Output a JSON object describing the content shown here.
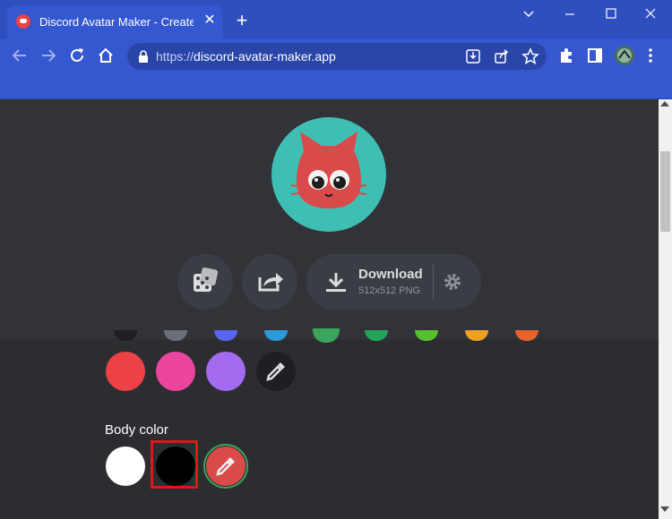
{
  "browser": {
    "tab_title": "Discord Avatar Maker - Create yo",
    "close_tab": "✕",
    "new_tab": "+",
    "url_scheme": "https://",
    "url_host": "discord-avatar-maker.app"
  },
  "download": {
    "label": "Download",
    "sublabel": "512x512 PNG"
  },
  "section": {
    "body_color_label": "Body color"
  },
  "colors": {
    "accent_green": "#3ba55c",
    "highlight_red": "#e0161b",
    "avatar_bg": "#3fbfb3",
    "avatar_cat": "#d94a4a",
    "swatch_red": "#ed4245",
    "swatch_pink": "#eb459e",
    "swatch_purple": "#a36cf0",
    "swatch_white": "#ffffff",
    "swatch_black": "#000000"
  },
  "icons": [
    "discord-icon",
    "close-icon",
    "plus-icon",
    "back-icon",
    "forward-icon",
    "reload-icon",
    "home-icon",
    "lock-icon",
    "install-icon",
    "share-icon",
    "star-icon",
    "puzzle-icon",
    "sidebar-icon",
    "profile-icon",
    "menu-icon",
    "dice-icon",
    "share-arrow-icon",
    "download-icon",
    "gear-icon",
    "eyedropper-icon"
  ]
}
